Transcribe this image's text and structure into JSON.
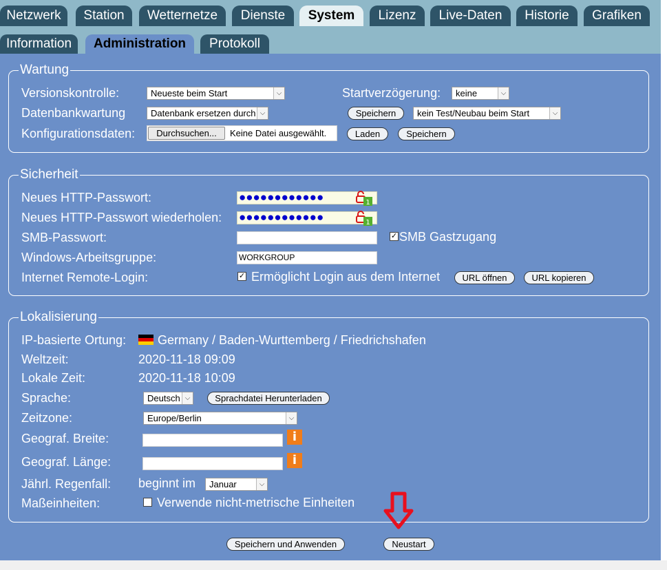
{
  "top_tabs": [
    {
      "label": "Netzwerk"
    },
    {
      "label": "Station"
    },
    {
      "label": "Wetternetze"
    },
    {
      "label": "Dienste"
    },
    {
      "label": "System"
    },
    {
      "label": "Lizenz"
    },
    {
      "label": "Live-Daten"
    },
    {
      "label": "Historie"
    },
    {
      "label": "Grafiken"
    }
  ],
  "sub_tabs": [
    {
      "label": "Information"
    },
    {
      "label": "Administration"
    },
    {
      "label": "Protokoll"
    }
  ],
  "wartung": {
    "legend": "Wartung",
    "version_label": "Versionskontrolle:",
    "version_value": "Neueste beim Start",
    "startdelay_label": "Startverzögerung:",
    "startdelay_value": "keine",
    "db_label": "Datenbankwartung",
    "db_value": "Datenbank ersetzen durch",
    "db_save": "Speichern",
    "db_test_value": "kein Test/Neubau beim Start",
    "config_label": "Konfigurationsdaten:",
    "browse_button": "Durchsuchen...",
    "no_file": "Keine Datei ausgewählt.",
    "load_button": "Laden",
    "config_save": "Speichern"
  },
  "sicherheit": {
    "legend": "Sicherheit",
    "http_pw_label": "Neues HTTP-Passwort:",
    "http_pw_value": "●●●●●●●●●●●●",
    "http_pw_repeat_label": "Neues HTTP-Passwort wiederholen:",
    "http_pw_repeat_value": "●●●●●●●●●●●●",
    "pw_manager_badge": "1",
    "smb_pw_label": "SMB-Passwort:",
    "smb_guest_label": "SMB Gastzugang",
    "smb_guest_checked": "✓",
    "workgroup_label": "Windows-Arbeitsgruppe:",
    "workgroup_value": "WORKGROUP",
    "remote_label": "Internet Remote-Login:",
    "remote_checked": "✓",
    "remote_text": "Ermöglicht Login aus dem Internet",
    "url_open": "URL öffnen",
    "url_copy": "URL kopieren"
  },
  "lokalisierung": {
    "legend": "Lokalisierung",
    "ip_label": "IP-basierte Ortung:",
    "ip_value": "Germany / Baden-Wurttemberg / Friedrichshafen",
    "utc_label": "Weltzeit:",
    "utc_value": "2020-11-18 09:09",
    "local_label": "Lokale Zeit:",
    "local_value": "2020-11-18 10:09",
    "lang_label": "Sprache:",
    "lang_value": "Deutsch",
    "lang_download": "Sprachdatei Herunterladen",
    "tz_label": "Zeitzone:",
    "tz_value": "Europe/Berlin",
    "lat_label": "Geograf. Breite:",
    "lon_label": "Geograf. Länge:",
    "info_glyph": "i",
    "rain_label": "Jährl. Regenfall:",
    "rain_prefix": "beginnt im",
    "rain_month": "Januar",
    "units_label": "Maßeinheiten:",
    "units_text": "Verwende nicht-metrische Einheiten"
  },
  "footer": {
    "save_apply": "Speichern und Anwenden",
    "restart": "Neustart"
  },
  "colors": {
    "panel": "#6b8fc8",
    "tab_dark": "#2e5468",
    "tab_strip": "#8fb8c8",
    "arrow": "#e8101e",
    "info": "#f07d1a"
  }
}
